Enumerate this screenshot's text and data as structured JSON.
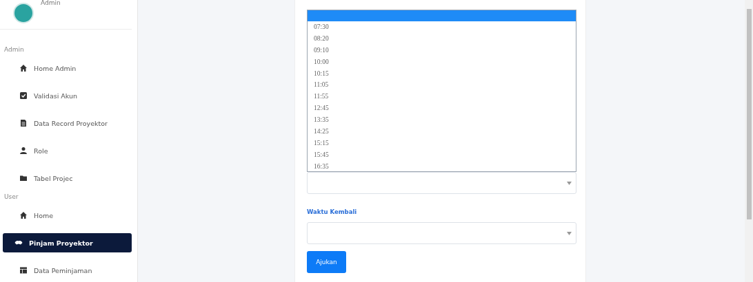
{
  "sidebar": {
    "user_name": "Admin",
    "sections": [
      {
        "title": "Admin",
        "items": [
          {
            "label": "Home Admin",
            "kind": "house",
            "selected": false
          },
          {
            "label": "Validasi Akun",
            "kind": "check",
            "selected": false
          },
          {
            "label": "Data Record Proyektor",
            "kind": "file",
            "selected": false
          },
          {
            "label": "Role",
            "kind": "user",
            "selected": false
          },
          {
            "label": "Tabel Projec",
            "kind": "folder",
            "selected": false
          }
        ]
      },
      {
        "title": "User",
        "items": [
          {
            "label": "Home",
            "kind": "house",
            "selected": false
          },
          {
            "label": "Pinjam Proyektor",
            "kind": "hands",
            "selected": true
          },
          {
            "label": "Data Peminjaman",
            "kind": "table",
            "selected": false
          }
        ]
      }
    ]
  },
  "form": {
    "time_list": {
      "blank_option_selected": true,
      "options": [
        {
          "label": "07:30",
          "selected": false
        },
        {
          "label": "08:20",
          "selected": false
        },
        {
          "label": "09:10",
          "selected": false
        },
        {
          "label": "10:00",
          "selected": false
        },
        {
          "label": "10:15",
          "selected": false
        },
        {
          "label": "11:05",
          "selected": false
        },
        {
          "label": "11:55",
          "selected": false
        },
        {
          "label": "12:45",
          "selected": false
        },
        {
          "label": "13:35",
          "selected": false
        },
        {
          "label": "14:25",
          "selected": false
        },
        {
          "label": "15:15",
          "selected": false
        },
        {
          "label": "15:45",
          "selected": false
        },
        {
          "label": "16:35",
          "selected": false
        }
      ]
    },
    "return_label": "Waktu Kembali",
    "submit": "Ajukan"
  }
}
